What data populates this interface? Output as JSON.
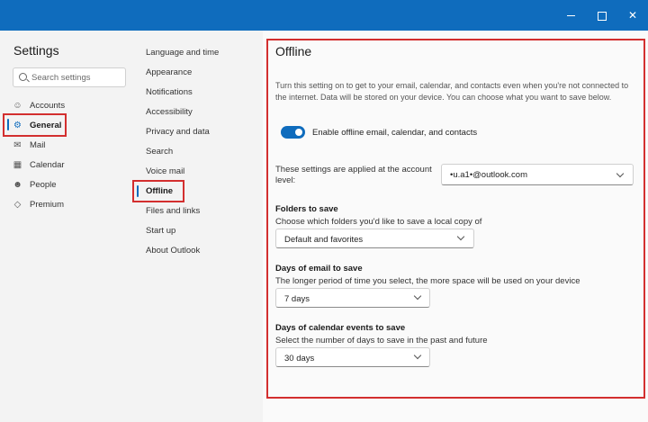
{
  "window": {
    "minimize_glyph": "",
    "maximize_glyph": "",
    "close_glyph": "✕"
  },
  "sidebar": {
    "title": "Settings",
    "search_placeholder": "Search settings",
    "items": [
      {
        "label": "Accounts",
        "icon": "person-icon",
        "glyph": "👤"
      },
      {
        "label": "General",
        "icon": "gear-icon",
        "glyph": "⚙"
      },
      {
        "label": "Mail",
        "icon": "mail-icon",
        "glyph": "✉"
      },
      {
        "label": "Calendar",
        "icon": "calendar-icon",
        "glyph": "▦"
      },
      {
        "label": "People",
        "icon": "people-icon",
        "glyph": "👥"
      },
      {
        "label": "Premium",
        "icon": "diamond-icon",
        "glyph": "◇"
      }
    ],
    "selected": "General"
  },
  "subnav": {
    "items": [
      "Language and time",
      "Appearance",
      "Notifications",
      "Accessibility",
      "Privacy and data",
      "Search",
      "Voice mail",
      "Offline",
      "Files and links",
      "Start up",
      "About Outlook"
    ],
    "selected": "Offline"
  },
  "main": {
    "title": "Offline",
    "description": "Turn this setting on to get to your email, calendar, and contacts even when you're not connected to the internet. Data will be stored on your device. You can choose what you want to save below.",
    "toggle_label": "Enable offline email, calendar, and contacts",
    "toggle_on": true,
    "account_label": "These settings are applied at the account level:",
    "account_value": "•u.a1•@outlook.com",
    "folders": {
      "title": "Folders to save",
      "desc": "Choose which folders you'd like to save a local copy of",
      "value": "Default and favorites"
    },
    "email_days": {
      "title": "Days of email to save",
      "desc": "The longer period of time you select, the more space will be used on your device",
      "value": "7 days"
    },
    "calendar_days": {
      "title": "Days of calendar events to save",
      "desc": "Select the number of days to save in the past and future",
      "value": "30 days"
    }
  },
  "colors": {
    "accent": "#0f6cbd",
    "highlight": "#d32f2f"
  }
}
